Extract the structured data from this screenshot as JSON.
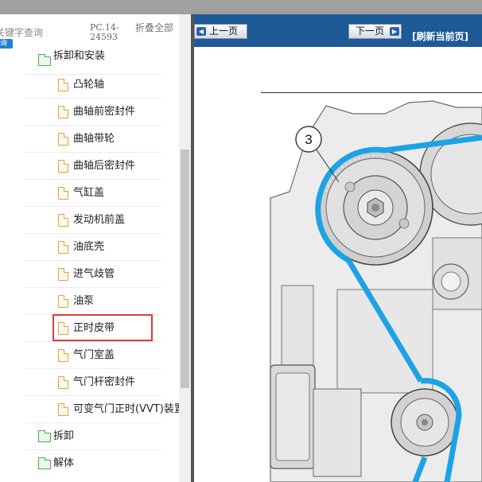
{
  "left_panel": {
    "search_label": "关键字查询",
    "search_button": "询",
    "pc_code": "PC.14-24593",
    "collapse_all": "折叠全部",
    "tree_items": [
      {
        "label": "拆卸和安装",
        "icon": "folder-icon"
      },
      {
        "label": "凸轮轴",
        "icon": "page-icon"
      },
      {
        "label": "曲轴前密封件",
        "icon": "page-icon"
      },
      {
        "label": "曲轴带轮",
        "icon": "page-icon"
      },
      {
        "label": "曲轴后密封件",
        "icon": "page-icon"
      },
      {
        "label": "气缸盖",
        "icon": "page-icon"
      },
      {
        "label": "发动机前盖",
        "icon": "page-icon"
      },
      {
        "label": "油底壳",
        "icon": "page-icon"
      },
      {
        "label": "进气歧管",
        "icon": "page-icon"
      },
      {
        "label": "油泵",
        "icon": "page-icon"
      },
      {
        "label": "正时皮带",
        "icon": "page-icon",
        "selected": true
      },
      {
        "label": "气门室盖",
        "icon": "page-icon"
      },
      {
        "label": "气门杆密封件",
        "icon": "page-icon"
      },
      {
        "label": "可变气门正时(VVT)装置",
        "icon": "page-icon"
      },
      {
        "label": "拆卸",
        "icon": "folder-icon"
      },
      {
        "label": "解体",
        "icon": "folder-icon"
      }
    ]
  },
  "right_panel": {
    "prev_button": "上一页",
    "next_button": "下一页",
    "refresh_link": "[刷新当前页]",
    "callout_number": "3"
  },
  "colors": {
    "toolbar": "#1d5a96",
    "belt": "#1ca3e6",
    "highlight": "#e33838"
  }
}
